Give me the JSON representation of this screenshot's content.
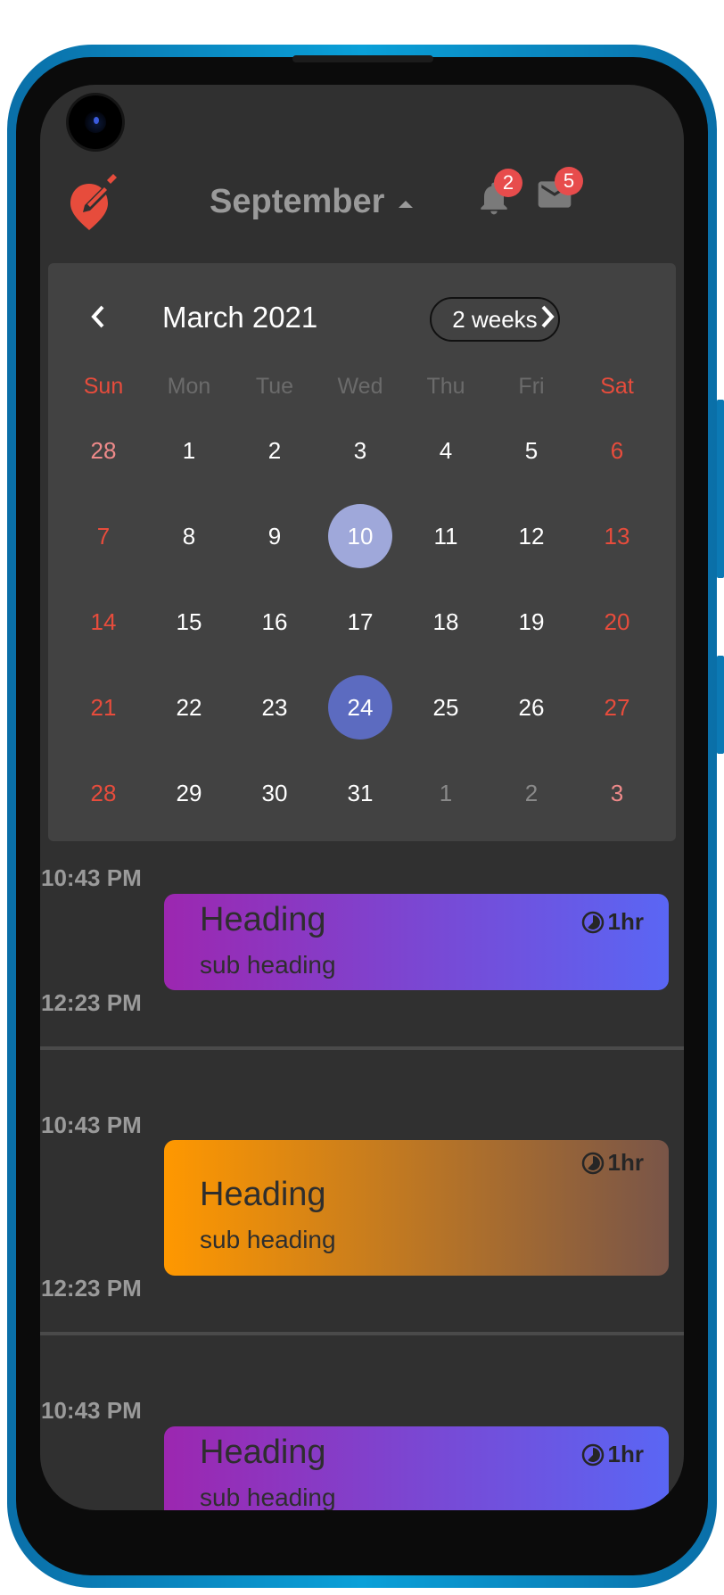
{
  "header": {
    "month_label": "September",
    "notifications_count": "2",
    "messages_count": "5"
  },
  "calendar": {
    "title": "March 2021",
    "range_button": "2 weeks",
    "weekdays": [
      "Sun",
      "Mon",
      "Tue",
      "Wed",
      "Thu",
      "Fri",
      "Sat"
    ],
    "days": [
      "28",
      "1",
      "2",
      "3",
      "4",
      "5",
      "6",
      "7",
      "8",
      "9",
      "10",
      "11",
      "12",
      "13",
      "14",
      "15",
      "16",
      "17",
      "18",
      "19",
      "20",
      "21",
      "22",
      "23",
      "24",
      "25",
      "26",
      "27",
      "28",
      "29",
      "30",
      "31",
      "1",
      "2",
      "3"
    ],
    "today": "10",
    "selected": "24"
  },
  "events": [
    {
      "start": "10:43 PM",
      "end": "12:23 PM",
      "heading": "Heading",
      "sub": "sub heading",
      "duration": "1hr"
    },
    {
      "start": "10:43 PM",
      "end": "12:23 PM",
      "heading": "Heading",
      "sub": "sub heading",
      "duration": "1hr"
    },
    {
      "start": "10:43 PM",
      "heading": "Heading",
      "sub": "sub heading",
      "duration": "1hr"
    }
  ],
  "colors": {
    "accent_red": "#e74c3c",
    "today_circle": "#9fa8da",
    "selected_circle": "#5c6bc0",
    "card_purple_start": "#9c27b0",
    "card_purple_end": "#5a66f4",
    "card_orange_start": "#ff9800",
    "card_orange_end": "#795548"
  },
  "icons": [
    "app-logo-icon",
    "notification-bell-icon",
    "mail-icon",
    "chevron-left-icon",
    "chevron-right-icon",
    "caret-up-icon",
    "timelapse-icon"
  ]
}
